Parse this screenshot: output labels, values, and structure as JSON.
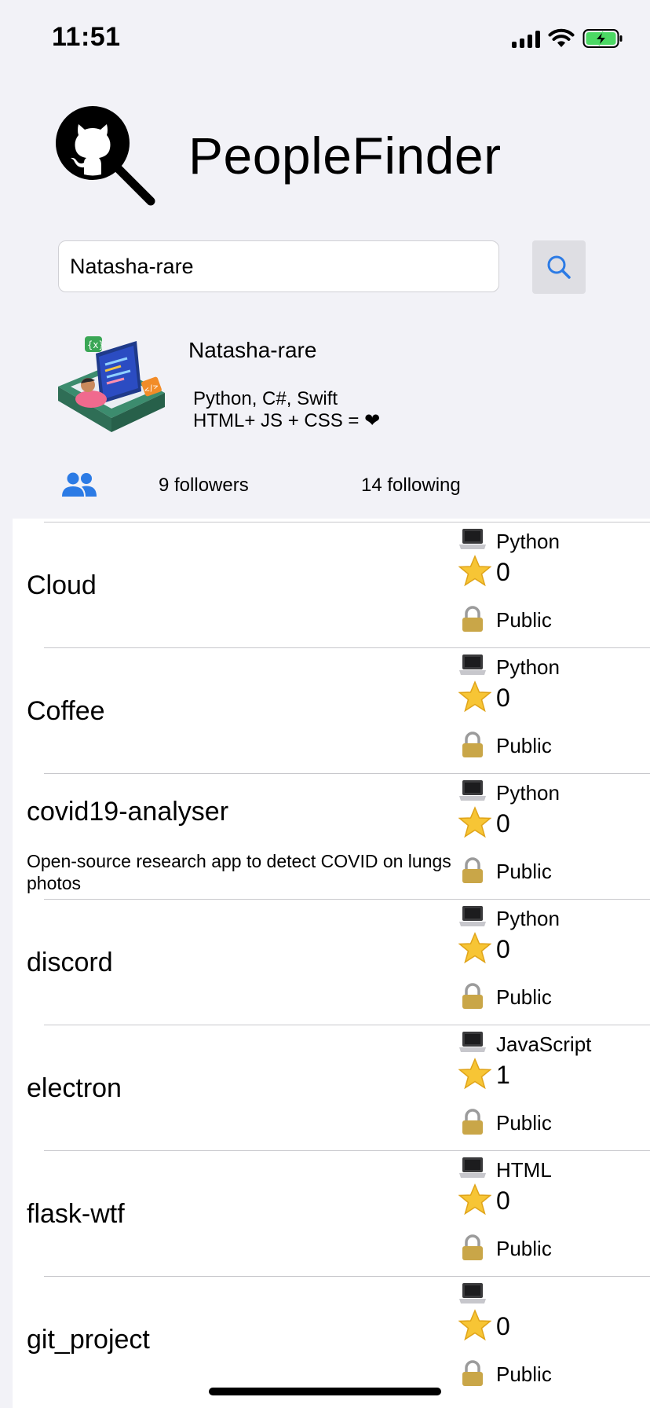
{
  "status_bar": {
    "time": "11:51"
  },
  "header": {
    "app_title": "PeopleFinder",
    "logo_icon": "github-search-icon"
  },
  "search": {
    "value": "Natasha-rare",
    "button_icon": "search-icon",
    "accent_color": "#2c7be5"
  },
  "profile": {
    "username": "Natasha-rare",
    "bio_line1": "Python, C#, Swift",
    "bio_line2": "HTML+ JS + CSS = ❤",
    "avatar_icon": "developer-illustration-icon"
  },
  "stats": {
    "followers": "9 followers",
    "following": "14 following",
    "icon": "people-icon",
    "icon_color": "#2c7be5"
  },
  "repos": [
    {
      "name": "Cloud",
      "description": "",
      "language": "Python",
      "stars": "0",
      "visibility": "Public"
    },
    {
      "name": "Coffee",
      "description": "",
      "language": "Python",
      "stars": "0",
      "visibility": "Public"
    },
    {
      "name": "covid19-analyser",
      "description": "Open-source research app to detect COVID on lungs photos",
      "language": "Python",
      "stars": "0",
      "visibility": "Public"
    },
    {
      "name": "discord",
      "description": "",
      "language": "Python",
      "stars": "0",
      "visibility": "Public"
    },
    {
      "name": "electron",
      "description": "",
      "language": "JavaScript",
      "stars": "1",
      "visibility": "Public"
    },
    {
      "name": "flask-wtf",
      "description": "",
      "language": "HTML",
      "stars": "0",
      "visibility": "Public"
    },
    {
      "name": "git_project",
      "description": "",
      "language": "",
      "stars": "0",
      "visibility": "Public"
    }
  ]
}
